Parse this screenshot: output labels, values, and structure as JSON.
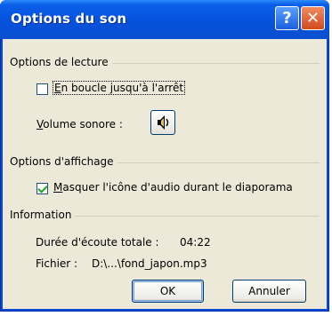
{
  "window": {
    "title": "Options du son",
    "help_glyph": "?",
    "close_glyph": "✕"
  },
  "playback": {
    "group_label": "Options de lecture",
    "loop_label_underlined": "E",
    "loop_label_rest": "n boucle jusqu'à l'arrêt",
    "loop_checked": false,
    "volume_label_underlined": "V",
    "volume_label_rest": "olume sonore :",
    "volume_icon": "speaker-icon"
  },
  "display": {
    "group_label": "Options d'affichage",
    "hide_icon_label_underlined": "M",
    "hide_icon_label_rest": "asquer l'icône d'audio durant le diaporama",
    "hide_icon_checked": true
  },
  "info": {
    "group_label": "Information",
    "duration_label": "Durée d'écoute totale :",
    "duration_value": "04:22",
    "file_label": "Fichier :",
    "file_value": "D:\\...\\fond_japon.mp3"
  },
  "buttons": {
    "ok": "OK",
    "cancel": "Annuler"
  },
  "colors": {
    "titlebar": "#0754e0",
    "client_bg": "#ece9d8",
    "check_mark": "#21a121"
  }
}
